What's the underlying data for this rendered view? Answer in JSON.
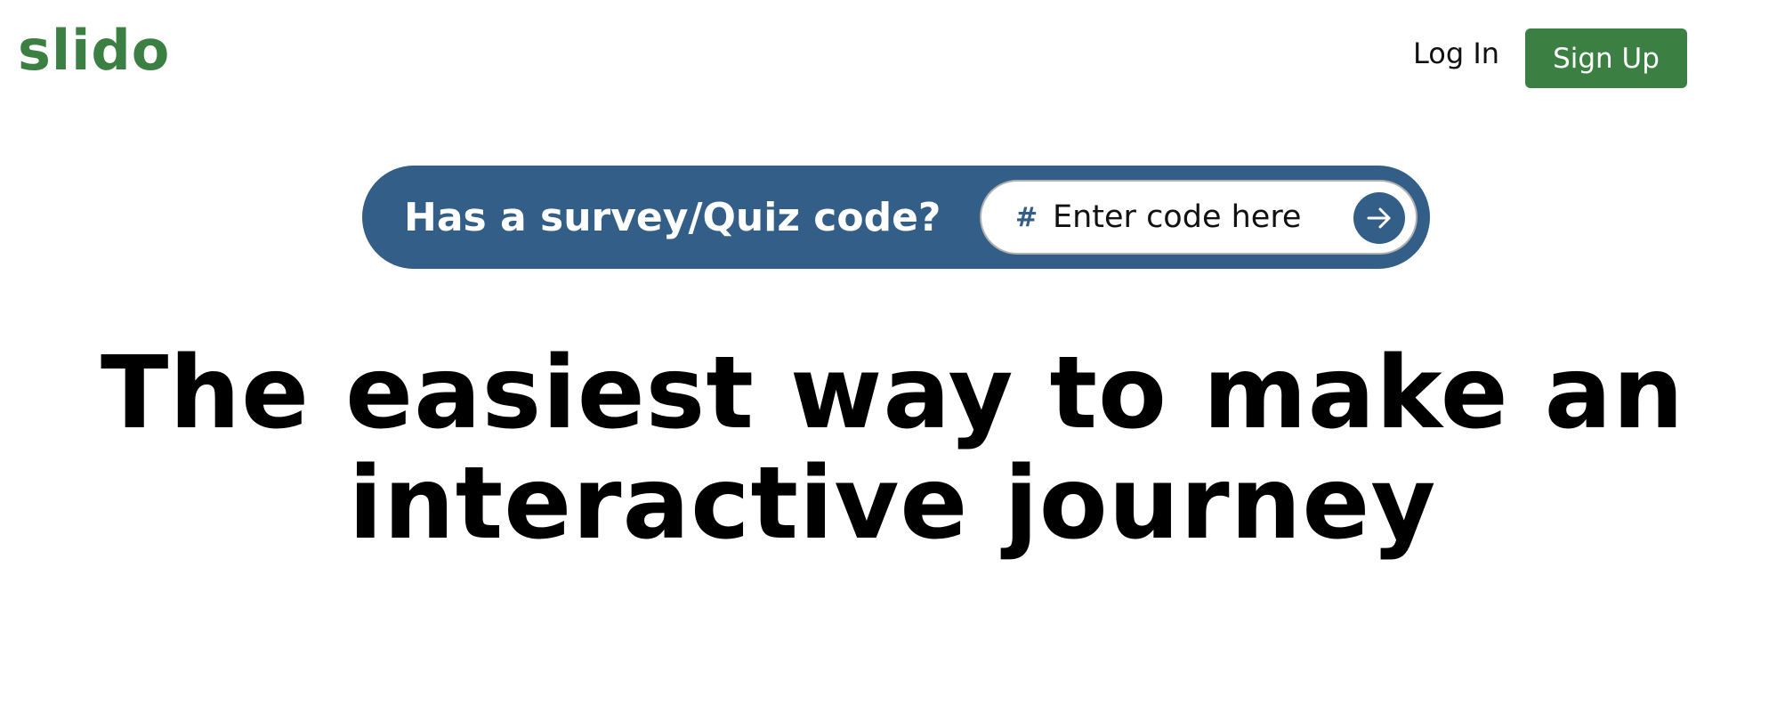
{
  "brand": {
    "name": "slido",
    "color": "#3b8042"
  },
  "nav": {
    "login_label": "Log In",
    "signup_label": "Sign Up",
    "signup_color": "#3b8042"
  },
  "code_entry": {
    "prompt": "Has a survey/Quiz code?",
    "hash_symbol": "#",
    "placeholder": "Enter code here",
    "submit_icon": "arrow-right-icon",
    "bar_color": "#325e87"
  },
  "hero": {
    "line1": "The easiest way to make an",
    "line2": "interactive journey"
  }
}
